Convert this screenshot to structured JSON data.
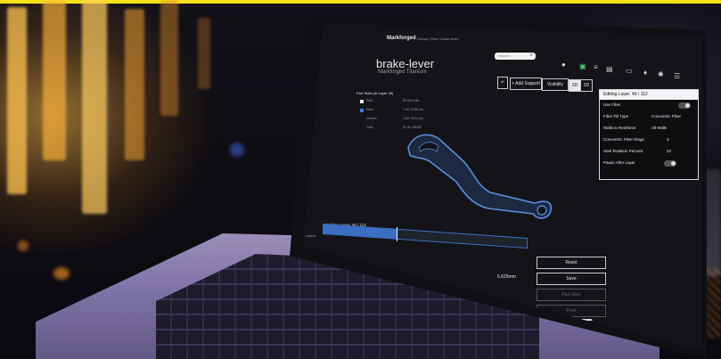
{
  "app": {
    "logo_text": "Markforged",
    "breadcrumb": "Library / Part / brake-lever",
    "search_placeholder": "Search"
  },
  "part": {
    "title": "brake-lever",
    "material": "Markforged Titanium"
  },
  "details": {
    "heading": "Part Stats (at Layer 40)",
    "rows": [
      {
        "label": "Print",
        "value": "3h 59m 48s"
      },
      {
        "label": "Fiber",
        "value": "1.40 / 6.85 cm³"
      },
      {
        "label": "Volume",
        "value": "4.80 / 6.81 cm³"
      },
      {
        "label": "Total",
        "value": "$1.41 / $5.58"
      }
    ]
  },
  "toolbar": {
    "support_label": "+ Add Support",
    "visibility_label": "Visibility",
    "view_2d": "2D",
    "view_3d": "3D"
  },
  "layer_panel": {
    "header": "Editing Layer: 40 / 112",
    "use_fiber_label": "Use Fiber",
    "fiber_fill_type_label": "Fiber Fill Type",
    "fiber_fill_type_value": "Concentric Fiber",
    "walls_label": "Walls to Reinforce",
    "walls_value": "All Walls",
    "rings_label": "Concentric Fiber Rings",
    "rings_value": "3",
    "start_label": "Start Rotation Percent",
    "start_value": "22",
    "pause_label": "Pause After Layer"
  },
  "timeline": {
    "label": "Editing Layer: 40 / 112",
    "left_label": "Layers",
    "value": "5.625mm",
    "progress": 0.36
  },
  "actions": {
    "reset": "Reset",
    "save": "Save",
    "part_view": "Part View",
    "print": "Print"
  },
  "colors": {
    "accent_yellow": "#f6e11a",
    "timeline_blue": "#3a6fc4",
    "part_blue": "#5a8ee0"
  }
}
